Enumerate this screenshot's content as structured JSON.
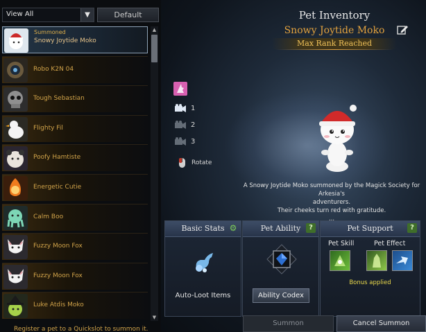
{
  "filter": {
    "value": "View All",
    "default_label": "Default"
  },
  "pets": [
    {
      "name": "Snowy Joytide Moko",
      "tag": "Summoned",
      "selected": true,
      "icon": "snowman-pet-icon"
    },
    {
      "name": "Robo K2N 04",
      "icon": "robot-pet-icon"
    },
    {
      "name": "Tough Sebastian",
      "icon": "skull-pet-icon"
    },
    {
      "name": "Flighty Fil",
      "icon": "duck-pet-icon"
    },
    {
      "name": "Poofy Hamtiste",
      "icon": "hamster-pet-icon"
    },
    {
      "name": "Energetic Cutie",
      "icon": "fire-spirit-pet-icon"
    },
    {
      "name": "Calm Boo",
      "icon": "octopus-pet-icon"
    },
    {
      "name": "Fuzzy Moon Fox",
      "icon": "fox-pet-icon"
    },
    {
      "name": "Fuzzy Moon Fox",
      "icon": "fox-pet-icon"
    },
    {
      "name": "Luke Atdis Moko",
      "icon": "witch-moko-pet-icon"
    }
  ],
  "hint": "Register a pet to a Quickslot to summon it.",
  "inventory": {
    "title": "Pet Inventory",
    "pet_name": "Snowy Joytide Moko",
    "rank": "Max Rank Reached",
    "description_lines": [
      "A Snowy Joytide Moko summoned by the Magick Society for Arkesia's",
      "adventurers.",
      "Their cheeks turn red with gratitude.",
      "..."
    ]
  },
  "controls": {
    "cams": [
      "1",
      "2",
      "3"
    ],
    "rotate": "Rotate"
  },
  "panels": {
    "basic_stats": {
      "title": "Basic Stats",
      "item": "Auto-Loot Items"
    },
    "pet_ability": {
      "title": "Pet Ability",
      "button": "Ability Codex"
    },
    "pet_support": {
      "title": "Pet Support",
      "skill": "Pet Skill",
      "effect": "Pet Effect",
      "bonus": "Bonus applied"
    }
  },
  "buttons": {
    "summon": "Summon",
    "cancel": "Cancel Summon"
  },
  "colors": {
    "gold": "#e3a23e",
    "accent_green": "#7fcf5a"
  }
}
